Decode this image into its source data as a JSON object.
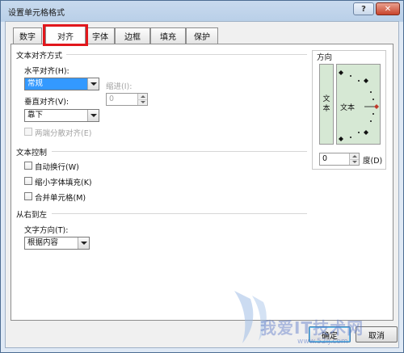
{
  "window": {
    "title": "设置单元格格式",
    "help_label": "?",
    "close_label": "✕"
  },
  "tabs": [
    "数字",
    "对齐",
    "字体",
    "边框",
    "填充",
    "保护"
  ],
  "active_tab": "对齐",
  "alignment": {
    "section_title": "文本对齐方式",
    "horizontal_label": "水平对齐(H):",
    "horizontal_value": "常规",
    "indent_label": "缩进(I):",
    "indent_value": "0",
    "vertical_label": "垂直对齐(V):",
    "vertical_value": "靠下",
    "justify_distributed_label": "两端分散对齐(E)"
  },
  "text_control": {
    "section_title": "文本控制",
    "wrap_text_label": "自动换行(W)",
    "shrink_to_fit_label": "缩小字体填充(K)",
    "merge_cells_label": "合并单元格(M)"
  },
  "rtl": {
    "section_title": "从右到左",
    "direction_label": "文字方向(T):",
    "direction_value": "根据内容"
  },
  "orientation": {
    "title": "方向",
    "vertical_text": [
      "文",
      "本"
    ],
    "dial_text": "文本",
    "degree_value": "0",
    "degree_label": "度(D)"
  },
  "buttons": {
    "ok_label": "确定",
    "cancel_label": "取消"
  },
  "watermark": {
    "text": "我爱IT技术网",
    "url": "www.52ij.com"
  },
  "colors": {
    "highlight": "#e2171c",
    "dial_pointer": "#c0392b",
    "preview_bg": "#d6e8d4"
  }
}
